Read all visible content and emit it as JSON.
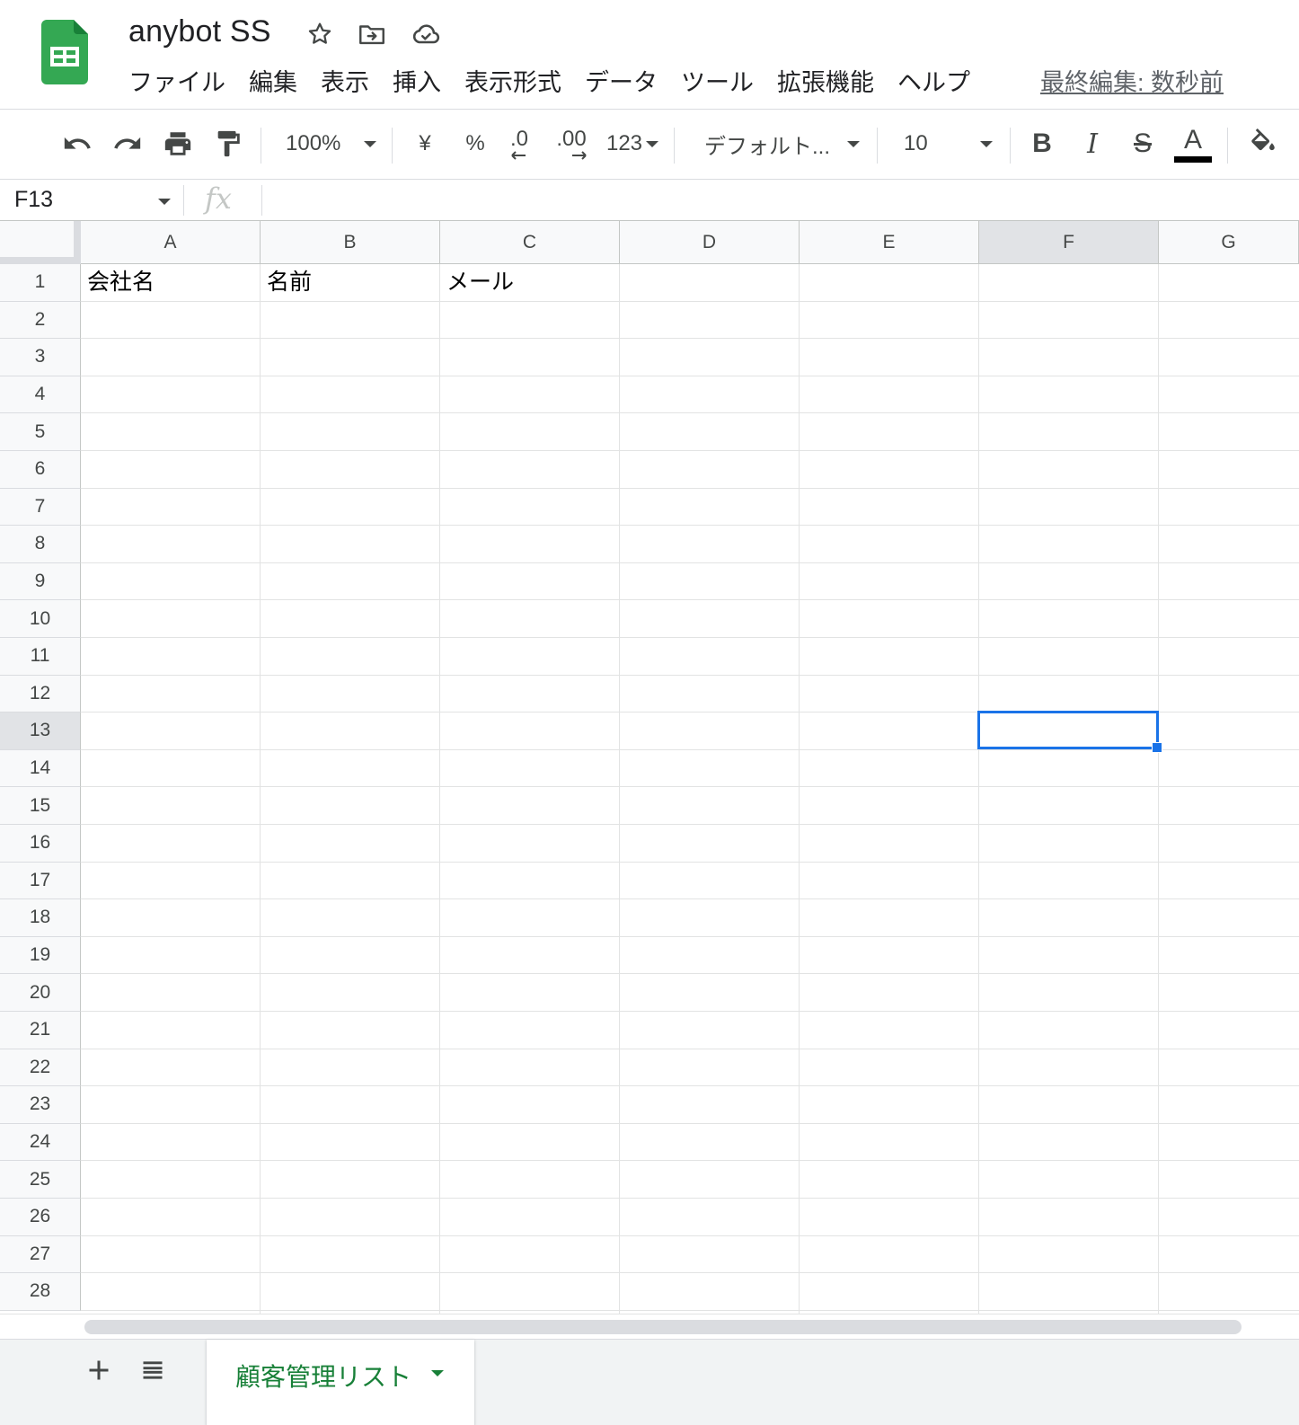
{
  "app": {
    "doc_title": "anybot SS",
    "logo_icon": "google-sheets-logo-icon",
    "title_icons": [
      "star-icon",
      "move-to-folder-icon",
      "cloud-saved-icon"
    ],
    "brand_color": "#34a853"
  },
  "menu": {
    "items": [
      "ファイル",
      "編集",
      "表示",
      "挿入",
      "表示形式",
      "データ",
      "ツール",
      "拡張機能",
      "ヘルプ"
    ],
    "last_edit": "最終編集: 数秒前"
  },
  "toolbar": {
    "zoom": "100%",
    "currency": "¥",
    "percent": "%",
    "decrease_decimal": ".0",
    "increase_decimal": ".00",
    "more_formats": "123",
    "font": "デフォルト...",
    "font_size": "10",
    "bold": "B",
    "italic": "I",
    "strikethrough": "S",
    "text_color_label": "A",
    "text_color": "#000000",
    "icons": [
      "undo-icon",
      "redo-icon",
      "print-icon",
      "paint-format-icon",
      "fill-color-icon"
    ]
  },
  "formula_bar": {
    "cell_ref": "F13",
    "fx": "fx",
    "value": ""
  },
  "grid": {
    "columns": [
      "A",
      "B",
      "C",
      "D",
      "E",
      "F",
      "G"
    ],
    "rows": [
      "1",
      "2",
      "3",
      "4",
      "5",
      "6",
      "7",
      "8",
      "9",
      "10",
      "11",
      "12",
      "13",
      "14",
      "15",
      "16",
      "17",
      "18",
      "19",
      "20",
      "21",
      "22",
      "23",
      "24",
      "25",
      "26",
      "27",
      "28"
    ],
    "selected_column": "F",
    "selected_row": "13",
    "cells": {
      "A1": "会社名",
      "B1": "名前",
      "C1": "メール"
    },
    "selection_color": "#1a73e8"
  },
  "sheets": {
    "tabs": [
      {
        "label": "顧客管理リスト",
        "active": true
      }
    ],
    "add_icon": "add-sheet-icon",
    "list_icon": "all-sheets-icon",
    "active_color": "#188038"
  }
}
